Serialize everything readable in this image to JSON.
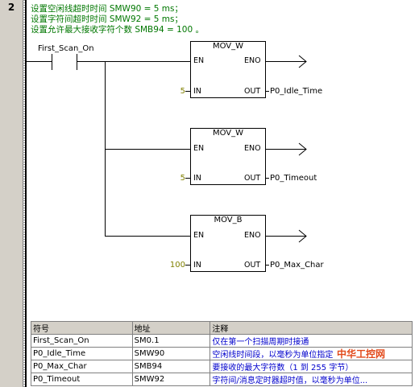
{
  "network": {
    "number": "2",
    "comments": [
      "设置空闲线超时时间 SMW90 = 5 ms；",
      "设置字符间超时时间 SMW92 = 5 ms；",
      "设置允许最大接收字符个数 SMB94 = 100 。"
    ],
    "contact_label": "First_Scan_On"
  },
  "boxes": [
    {
      "title": "MOV_W",
      "en": "EN",
      "eno": "ENO",
      "in": "IN",
      "out": "OUT",
      "in_value": "5",
      "out_symbol": "P0_Idle_Time"
    },
    {
      "title": "MOV_W",
      "en": "EN",
      "eno": "ENO",
      "in": "IN",
      "out": "OUT",
      "in_value": "5",
      "out_symbol": "P0_Timeout"
    },
    {
      "title": "MOV_B",
      "en": "EN",
      "eno": "ENO",
      "in": "IN",
      "out": "OUT",
      "in_value": "100",
      "out_symbol": "P0_Max_Char"
    }
  ],
  "symbol_table": {
    "headers": [
      "符号",
      "地址",
      "注释"
    ],
    "rows": [
      [
        "First_Scan_On",
        "SM0.1",
        "仅在第一个扫描周期时接通"
      ],
      [
        "P0_Idle_Time",
        "SMW90",
        "空闲线时间段，以毫秒为单位指定"
      ],
      [
        "P0_Max_Char",
        "SMB94",
        "要接收的最大字符数（1 到 255 字节）"
      ],
      [
        "P0_Timeout",
        "SMW92",
        "字符间/消息定时器超时值，以毫秒为单位..."
      ]
    ]
  },
  "watermark": "中华工控网",
  "colors": {
    "comment": "#007700",
    "input_value": "#808000",
    "gutter": "#d4d0c8"
  }
}
